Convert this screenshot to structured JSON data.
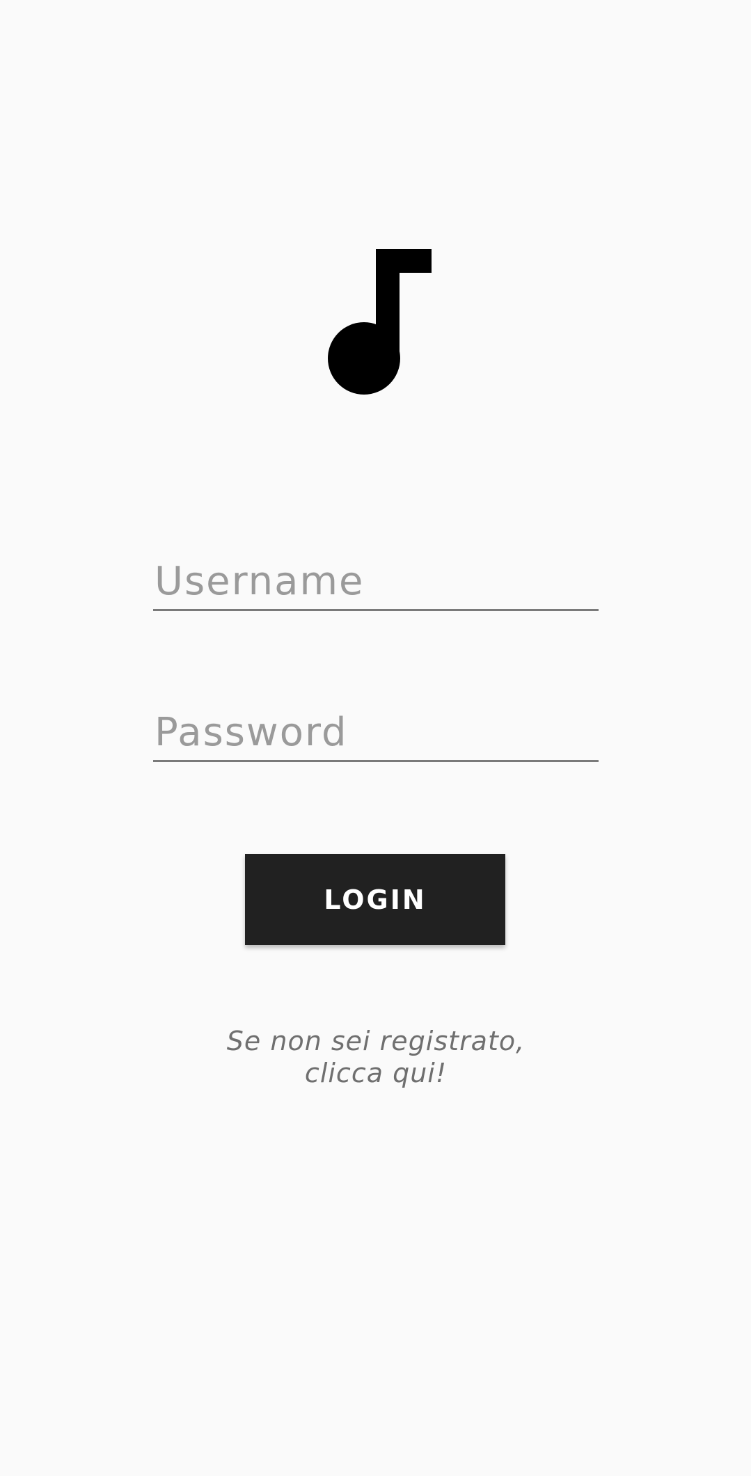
{
  "logo": {
    "icon": "music-note-icon",
    "color": "#000000"
  },
  "form": {
    "username_placeholder": "Username",
    "password_placeholder": "Password",
    "login_label": "LOGIN"
  },
  "register": {
    "line1": "Se non sei registrato,",
    "line2": "clicca qui!"
  },
  "colors": {
    "background": "#fafafa",
    "button": "#212121",
    "placeholder": "#9a9a9a",
    "link": "#6f6f6f"
  }
}
